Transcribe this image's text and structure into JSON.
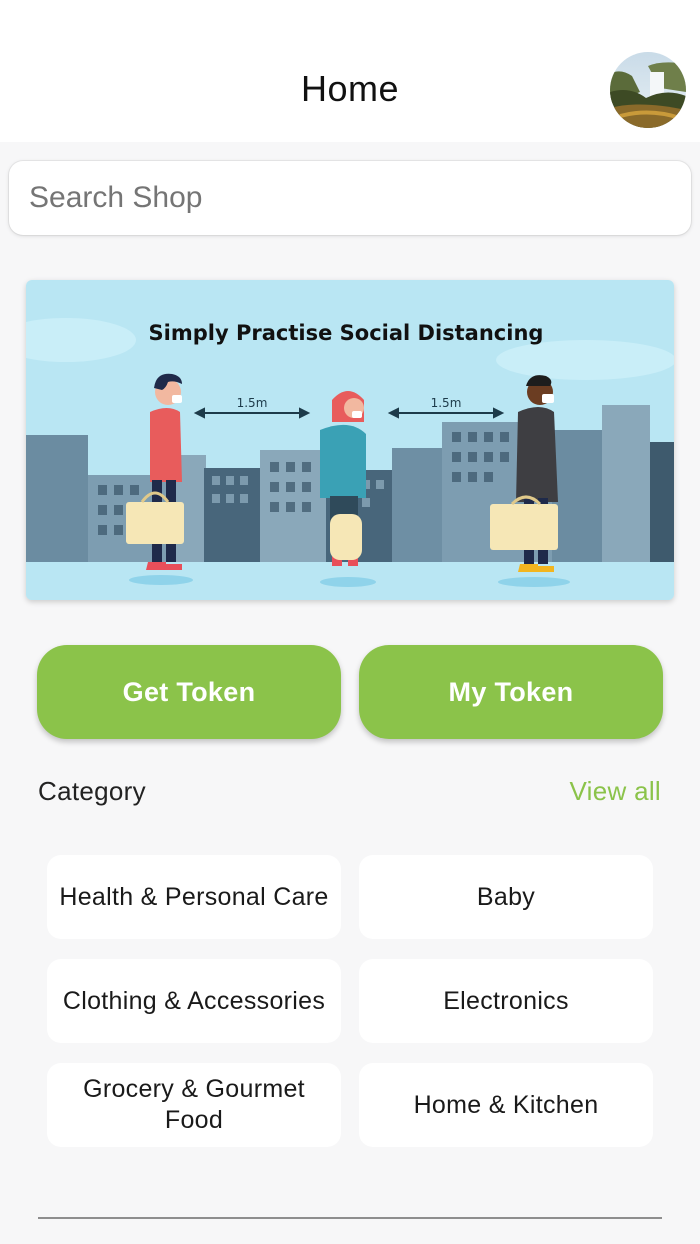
{
  "header": {
    "title": "Home"
  },
  "search": {
    "placeholder": "Search Shop",
    "value": ""
  },
  "banner": {
    "headline": "Simply Practise Social Distancing",
    "distance_left": "1.5m",
    "distance_right": "1.5m"
  },
  "buttons": {
    "get_token": "Get Token",
    "my_token": "My Token"
  },
  "category": {
    "title": "Category",
    "view_all": "View all",
    "items": [
      {
        "label": "Health & Personal Care"
      },
      {
        "label": "Baby"
      },
      {
        "label": "Clothing & Accessories"
      },
      {
        "label": "Electronics"
      },
      {
        "label": "Grocery & Gourmet Food"
      },
      {
        "label": "Home & Kitchen"
      }
    ]
  },
  "colors": {
    "accent": "#8bc34a",
    "background": "#f7f7f8",
    "card": "#ffffff",
    "banner_sky": "#b9e6f3"
  }
}
